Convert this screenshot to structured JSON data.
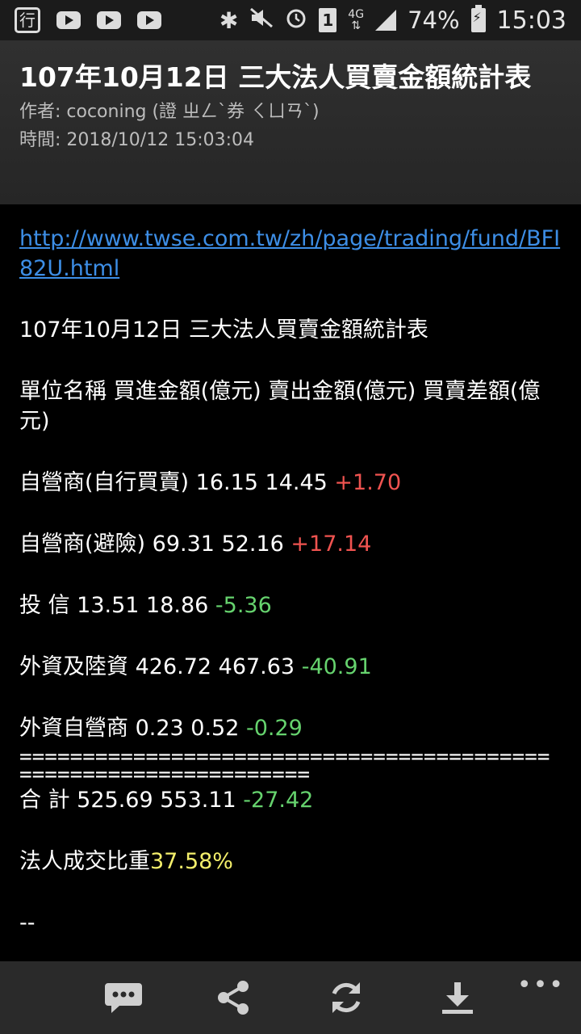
{
  "status_bar": {
    "battery": "74%",
    "time": "15:03",
    "network": "4G"
  },
  "post": {
    "title": "107年10月12日 三大法人買賣金額統計表",
    "author": "作者: coconing (證 ㄓㄥˋ券 ㄑㄩㄢˋ)",
    "time": "時間: 2018/10/12 15:03:04"
  },
  "content": {
    "link": "http://www.twse.com.tw/zh/page/trading/fund/BFI82U.html",
    "heading": "107年10月12日 三大法人買賣金額統計表",
    "columns": "單位名稱 買進金額(億元) 賣出金額(億元) 買賣差額(億元)",
    "rows": [
      {
        "label": "自營商(自行買賣) 16.15 14.45 ",
        "diff": "+1.70"
      },
      {
        "label": "自營商(避險) 69.31 52.16 ",
        "diff": "+17.14"
      },
      {
        "label": "投 信 13.51 18.86 ",
        "diff": "-5.36"
      },
      {
        "label": "外資及陸資 426.72 467.63 ",
        "diff": "-40.91"
      },
      {
        "label": "外資自營商 0.23 0.52 ",
        "diff": "-0.29"
      }
    ],
    "separator": "=================================================================",
    "total": {
      "label": "合 計 525.69 553.11 ",
      "diff": "-27.42"
    },
    "ratio_label": "法人成交比重",
    "ratio_value": "37.58%",
    "signature": "--"
  },
  "colors": {
    "positive": "#ef5350",
    "negative": "#66d36e",
    "highlight": "#f4ef6b",
    "link": "#3d8ee6"
  },
  "toolbar": {
    "icons": [
      "comment-icon",
      "share-icon",
      "refresh-icon",
      "download-icon",
      "more-icon"
    ]
  }
}
